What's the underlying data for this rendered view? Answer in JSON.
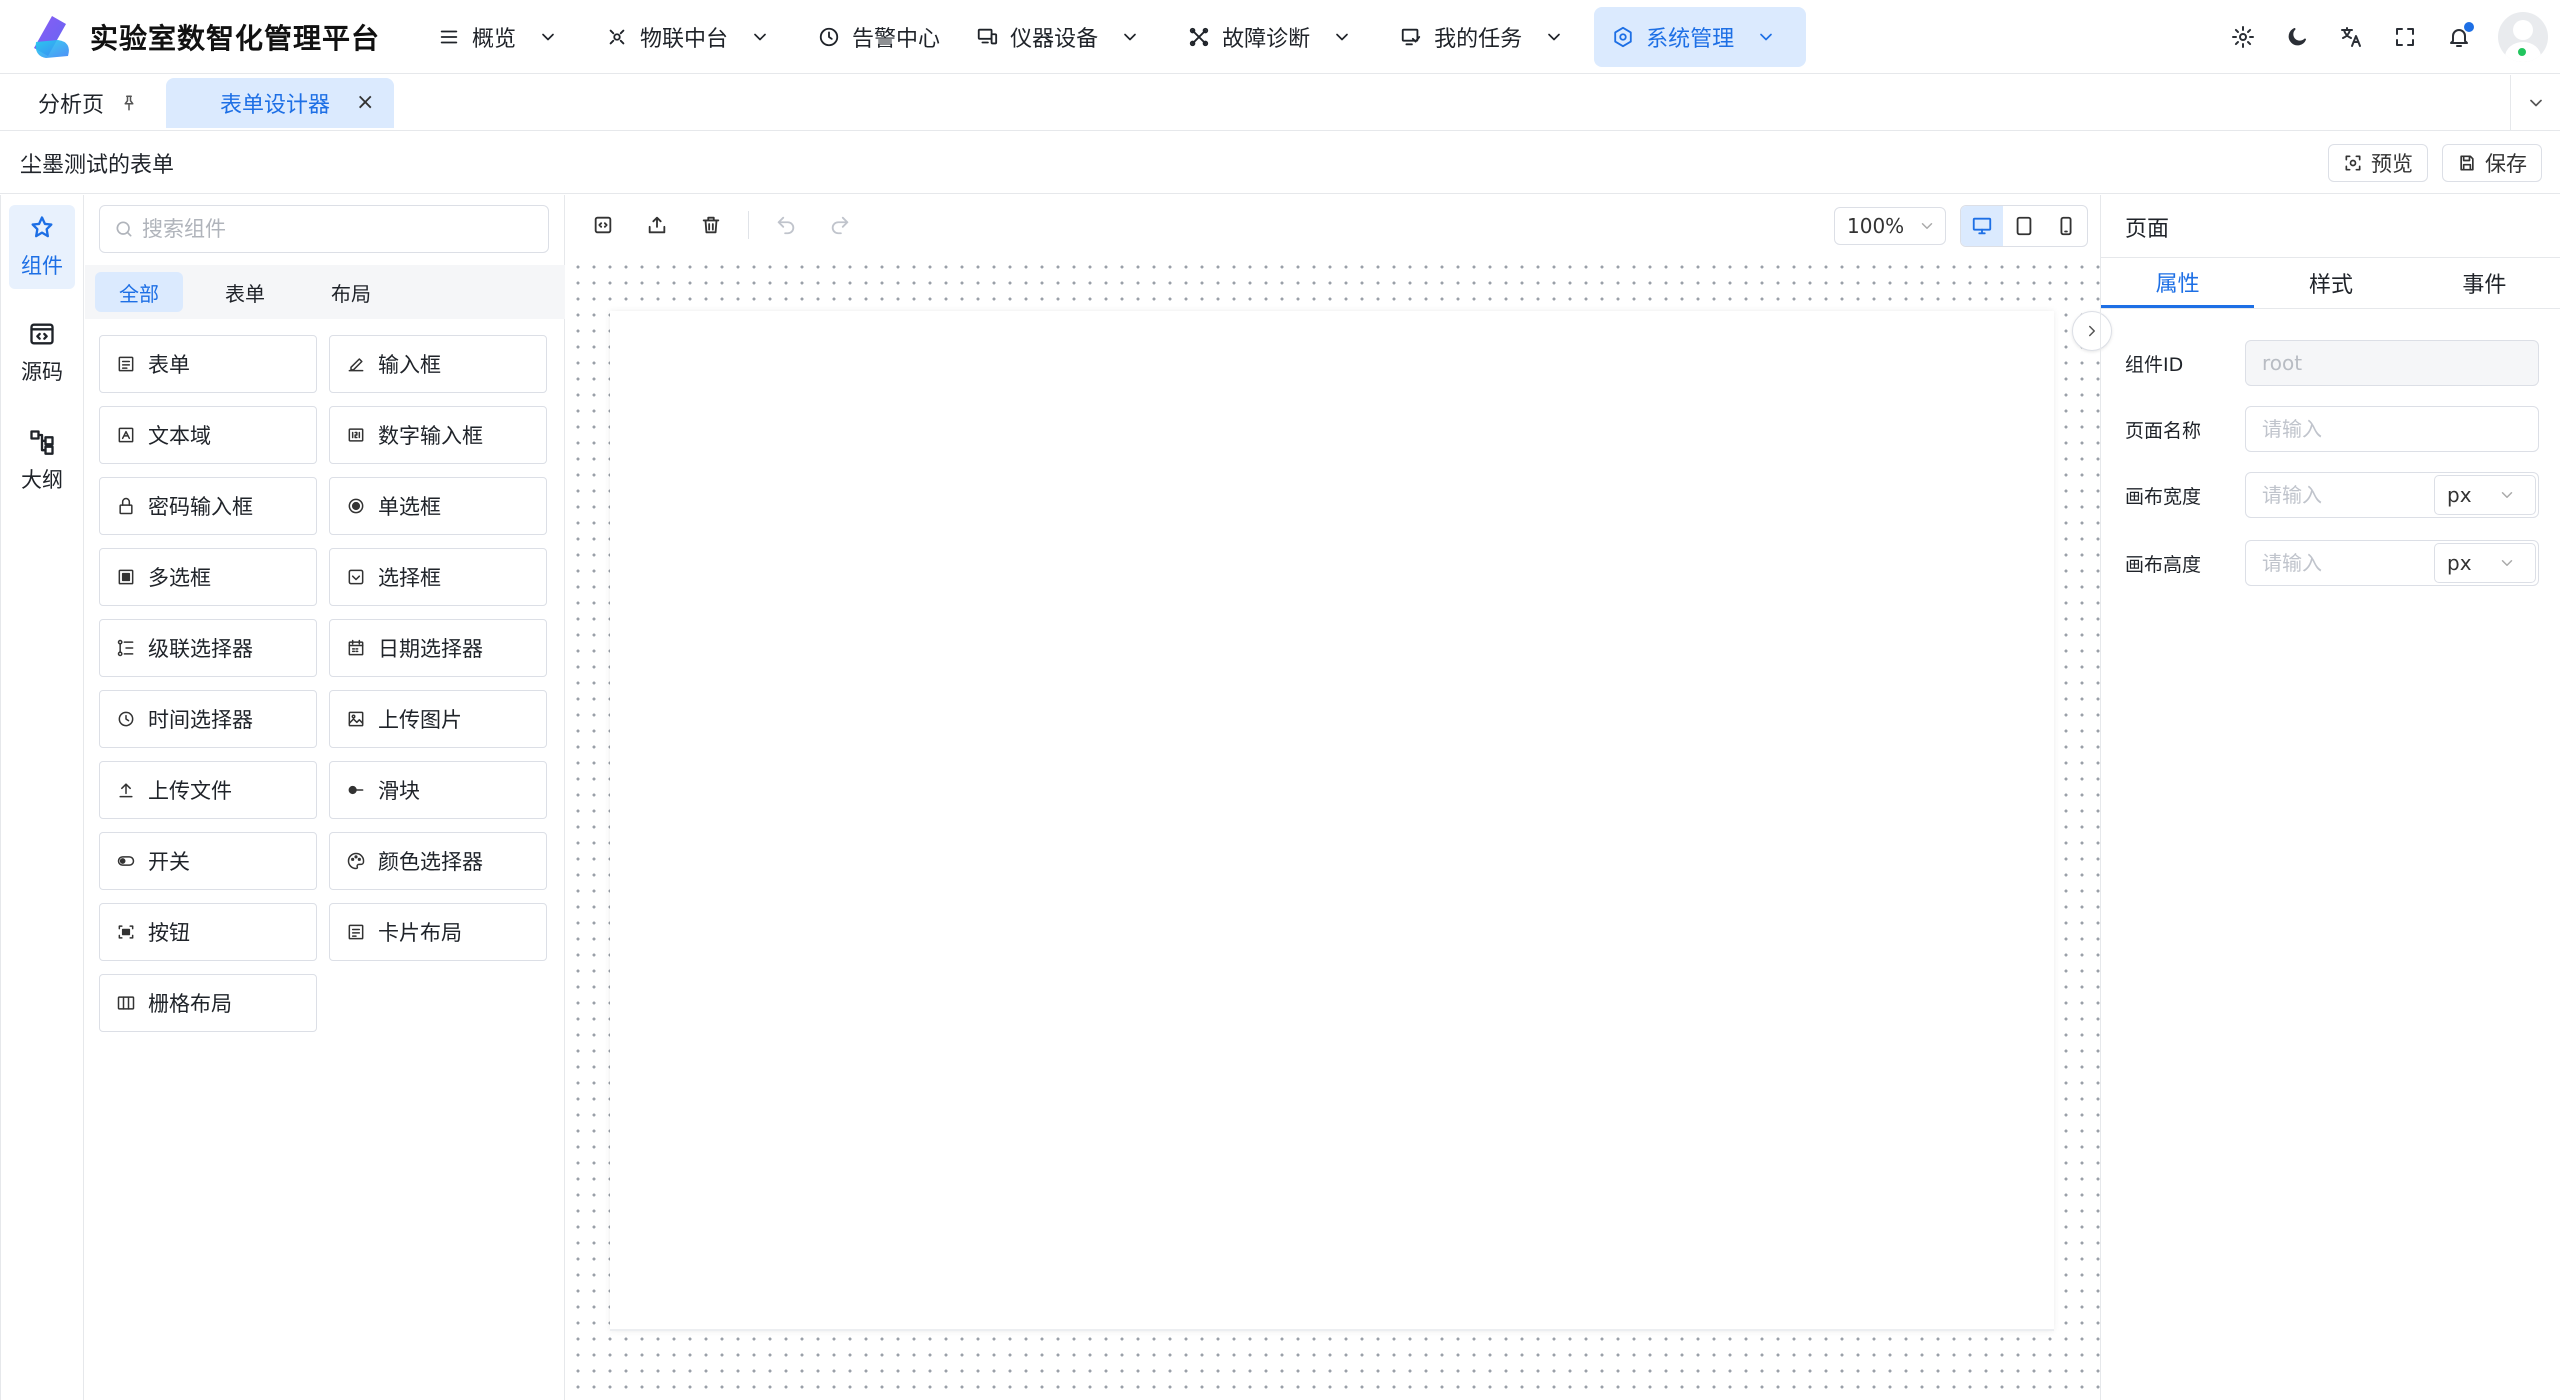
{
  "app": {
    "title": "实验室数智化管理平台"
  },
  "nav": [
    {
      "label": "概览",
      "icon": "menu-icon"
    },
    {
      "label": "物联中台",
      "icon": "iot-icon"
    },
    {
      "label": "告警中心",
      "icon": "clock-icon"
    },
    {
      "label": "仪器设备",
      "icon": "devices-icon"
    },
    {
      "label": "故障诊断",
      "icon": "diagnosis-icon"
    },
    {
      "label": "我的任务",
      "icon": "task-icon"
    },
    {
      "label": "系统管理",
      "icon": "gear-icon",
      "active": true
    }
  ],
  "tabs": [
    {
      "label": "分析页",
      "pinned": true
    },
    {
      "label": "表单设计器",
      "active": true,
      "close": "×"
    }
  ],
  "page": {
    "form_name": "尘墨测试的表单",
    "preview_label": "预览",
    "save_label": "保存"
  },
  "rail": [
    {
      "label": "组件",
      "active": true
    },
    {
      "label": "源码"
    },
    {
      "label": "大纲"
    }
  ],
  "components_panel": {
    "search_placeholder": "搜索组件",
    "categories": [
      {
        "label": "全部",
        "active": true
      },
      {
        "label": "表单"
      },
      {
        "label": "布局"
      }
    ],
    "items": [
      {
        "label": "表单",
        "icon": "form-icon"
      },
      {
        "label": "输入框",
        "icon": "pencil-icon"
      },
      {
        "label": "文本域",
        "icon": "textarea-icon"
      },
      {
        "label": "数字输入框",
        "icon": "number-input-icon"
      },
      {
        "label": "密码输入框",
        "icon": "lock-icon"
      },
      {
        "label": "单选框",
        "icon": "radio-icon"
      },
      {
        "label": "多选框",
        "icon": "checkbox-icon"
      },
      {
        "label": "选择框",
        "icon": "select-icon"
      },
      {
        "label": "级联选择器",
        "icon": "cascader-icon"
      },
      {
        "label": "日期选择器",
        "icon": "calendar-icon"
      },
      {
        "label": "时间选择器",
        "icon": "time-icon"
      },
      {
        "label": "上传图片",
        "icon": "image-icon"
      },
      {
        "label": "上传文件",
        "icon": "upload-icon"
      },
      {
        "label": "滑块",
        "icon": "slider-icon"
      },
      {
        "label": "开关",
        "icon": "switch-icon"
      },
      {
        "label": "颜色选择器",
        "icon": "palette-icon"
      },
      {
        "label": "按钮",
        "icon": "button-icon"
      },
      {
        "label": "卡片布局",
        "icon": "card-icon"
      },
      {
        "label": "栅格布局",
        "icon": "grid-icon"
      }
    ]
  },
  "canvas": {
    "zoom": "100%",
    "device": "desktop"
  },
  "props_panel": {
    "title": "页面",
    "tabs": [
      {
        "label": "属性",
        "active": true
      },
      {
        "label": "样式"
      },
      {
        "label": "事件"
      }
    ],
    "fields": {
      "component_id": {
        "label": "组件ID",
        "placeholder": "root"
      },
      "page_name": {
        "label": "页面名称",
        "placeholder": "请输入"
      },
      "canvas_width": {
        "label": "画布宽度",
        "placeholder": "请输入",
        "unit": "px"
      },
      "canvas_height": {
        "label": "画布高度",
        "placeholder": "请输入",
        "unit": "px"
      }
    }
  },
  "colors": {
    "accent": "#1d6fe5",
    "accent_bg": "#dbeafe",
    "border": "#dcdfe6"
  }
}
